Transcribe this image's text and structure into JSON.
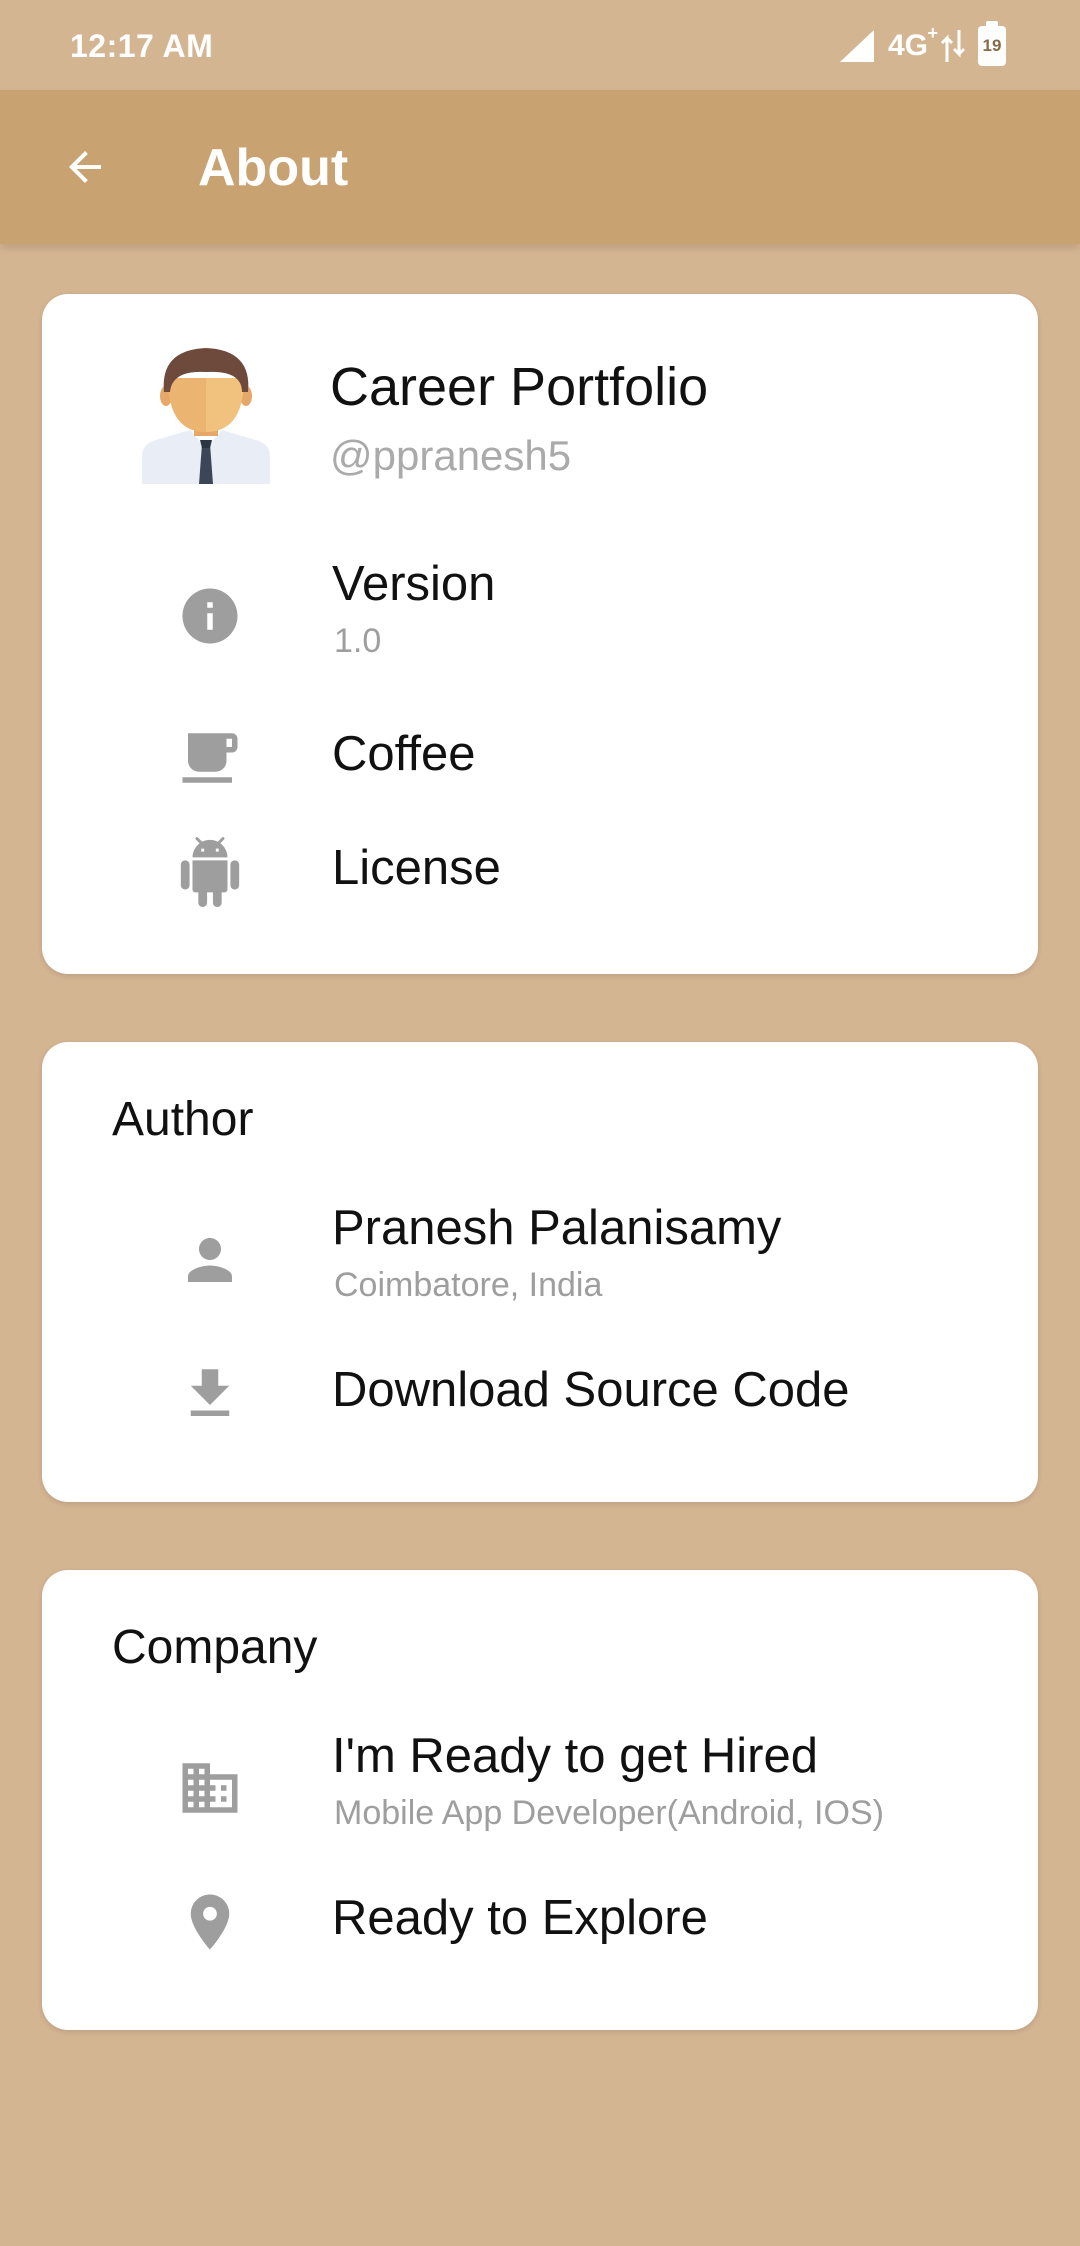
{
  "status_bar": {
    "time": "12:17 AM",
    "network": "4G",
    "network_plus": "+",
    "battery_level": "19"
  },
  "app_bar": {
    "title": "About"
  },
  "colors": {
    "background": "#d4b592",
    "app_bar": "#c9a272",
    "card": "#ffffff",
    "icon": "#9e9e9e"
  },
  "app_card": {
    "name": "Career Portfolio",
    "handle": "@ppranesh5",
    "items": [
      {
        "icon": "info-icon",
        "label": "Version",
        "sub": "1.0"
      },
      {
        "icon": "coffee-icon",
        "label": "Coffee"
      },
      {
        "icon": "android-icon",
        "label": "License"
      }
    ]
  },
  "author_card": {
    "heading": "Author",
    "items": [
      {
        "icon": "person-icon",
        "label": "Pranesh Palanisamy",
        "sub": "Coimbatore, India"
      },
      {
        "icon": "download-icon",
        "label": "Download Source Code"
      }
    ]
  },
  "company_card": {
    "heading": "Company",
    "items": [
      {
        "icon": "business-icon",
        "label": "I'm Ready to get Hired",
        "sub": "Mobile App Developer(Android, IOS)"
      },
      {
        "icon": "location-pin-icon",
        "label": "Ready to Explore"
      }
    ]
  }
}
